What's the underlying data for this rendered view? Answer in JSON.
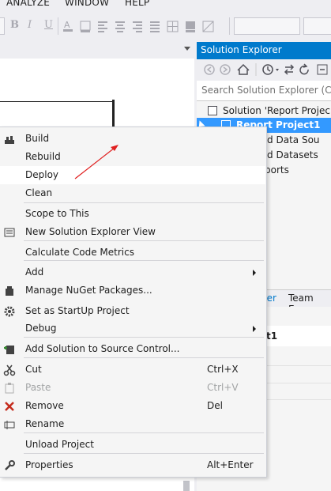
{
  "menubar": {
    "items": [
      "ANALYZE",
      "WINDOW",
      "HELP"
    ]
  },
  "toolbar": {
    "bold": "B",
    "italic": "I",
    "underline": "U"
  },
  "solution_explorer": {
    "title": "Solution Explorer",
    "search_placeholder": "Search Solution Explorer (Ct",
    "tree": [
      {
        "label": "Solution 'Report Projec"
      },
      {
        "label": "Report Project1"
      },
      {
        "label": "red Data Sou"
      },
      {
        "label": "red Datasets"
      },
      {
        "label": "ports"
      }
    ],
    "tabs": [
      "rer",
      "Team Exp"
    ],
    "props_title": "t1"
  },
  "context_menu": {
    "items": [
      {
        "label": "Build",
        "icon": "build-icon"
      },
      {
        "label": "Rebuild"
      },
      {
        "label": "Deploy",
        "highlighted": true
      },
      {
        "label": "Clean"
      },
      {
        "label": "Scope to This"
      },
      {
        "label": "New Solution Explorer View",
        "icon": "new-view-icon"
      },
      {
        "label": "Calculate Code Metrics"
      },
      {
        "label": "Add",
        "submenu": true
      },
      {
        "label": "Manage NuGet Packages...",
        "icon": "nuget-icon"
      },
      {
        "label": "Set as StartUp Project",
        "icon": "gear-icon"
      },
      {
        "label": "Debug",
        "submenu": true
      },
      {
        "label": "Add Solution to Source Control...",
        "icon": "source-control-icon"
      },
      {
        "label": "Cut",
        "shortcut": "Ctrl+X",
        "icon": "scissors-icon"
      },
      {
        "label": "Paste",
        "shortcut": "Ctrl+V",
        "disabled": true,
        "icon": "paste-icon"
      },
      {
        "label": "Remove",
        "shortcut": "Del",
        "icon": "remove-icon"
      },
      {
        "label": "Rename",
        "icon": "rename-icon"
      },
      {
        "label": "Unload Project"
      },
      {
        "label": "Properties",
        "shortcut": "Alt+Enter",
        "icon": "wrench-icon"
      }
    ]
  },
  "colors": {
    "accent": "#007acc",
    "annotation_arrow": "#e02020",
    "remove_icon": "#c42b1c"
  }
}
